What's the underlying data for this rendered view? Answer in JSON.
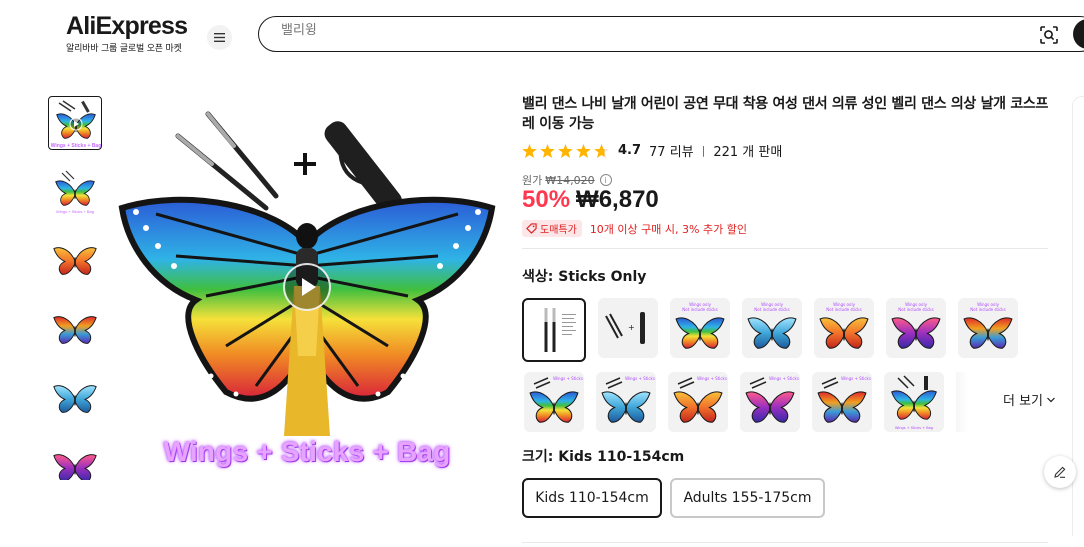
{
  "header": {
    "logo_text": "AliExpress",
    "logo_sub": "알리바바 그룹 글로벌 오픈 마켓",
    "search_placeholder": "밸리윙"
  },
  "gallery": {
    "thumbnails": [
      "thumb-1",
      "thumb-2",
      "thumb-3",
      "thumb-4",
      "thumb-5",
      "thumb-6"
    ],
    "main_caption": "Wings + Sticks + Bag",
    "thumb_caption": "Wings + Sticks + Bag"
  },
  "product": {
    "title": "밸리 댄스 나비 날개 어린이 공연 무대 착용 여성 댄서 의류 성인 벨리 댄스 의상 날개 코스프레 이동 가능",
    "rating": "4.7",
    "reviews": "77 리뷰",
    "sold": "221 개 판매",
    "original_label": "원가",
    "original_price": "₩14,020",
    "discount": "50%",
    "price": "₩6,870",
    "promo_badge": "도매특가",
    "promo_text": "10개 이상 구매 시, 3% 추가 할인"
  },
  "variants": {
    "color_label": "색상: Sticks Only",
    "more_label": "더 보기",
    "size_label": "크기: Kids 110-154cm",
    "sizes": [
      "Kids 110-154cm",
      "Adults 155-175cm"
    ],
    "tag_texts": {
      "wings_only": "Wings only",
      "not_include": "Not include sticks",
      "wings_sticks": "Wings + Sticks"
    }
  },
  "colors": {
    "accent_red": "#fd384f",
    "promo_red": "#e02020",
    "caption_purple": "#e6a4ff",
    "star": "#ffb400"
  }
}
